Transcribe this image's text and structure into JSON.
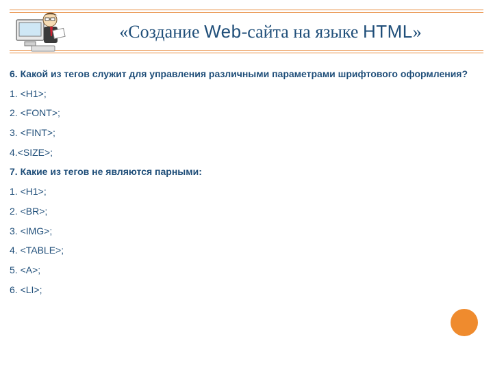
{
  "title": {
    "open_quote": "«",
    "part1": "Создание ",
    "web": "Web",
    "part2": "-сайта на языке ",
    "html": "HTML",
    "close_quote": "»"
  },
  "q6": {
    "text": "6. Какой из тегов служит для управления различными параметрами шрифтового оформления?",
    "opts": [
      "1. <H1>;",
      "2. <FONT>;",
      "3. <FINT>;",
      "4.<SIZE>;"
    ]
  },
  "q7": {
    "text": "7. Какие из тегов не являются парными:",
    "opts": [
      "1. <H1>;",
      "2. <BR>;",
      "3. <IMG>;",
      "4. <TABLE>;",
      "5. <A>;",
      "6. <LI>;"
    ]
  }
}
